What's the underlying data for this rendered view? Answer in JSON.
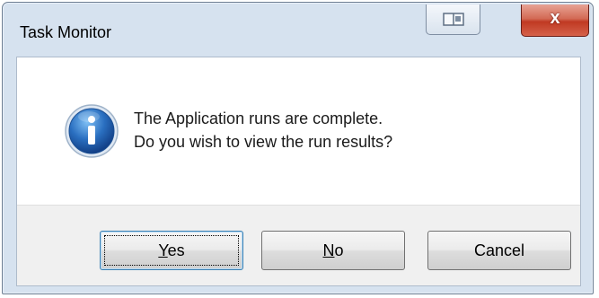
{
  "window": {
    "title": "Task Monitor"
  },
  "title_bar": {
    "restore_icon": "restore-window-icon",
    "close_label": "x",
    "close_color": "#c8452e"
  },
  "dialog": {
    "icon": "info-icon",
    "icon_color": "#2a6fc0",
    "message_line1": "The Application runs are complete.",
    "message_line2": "Do you wish to view the run results?"
  },
  "buttons": {
    "yes": {
      "mnemonic": "Y",
      "rest": "es"
    },
    "no": {
      "mnemonic": "N",
      "rest": "o"
    },
    "cancel": {
      "label": "Cancel"
    }
  }
}
